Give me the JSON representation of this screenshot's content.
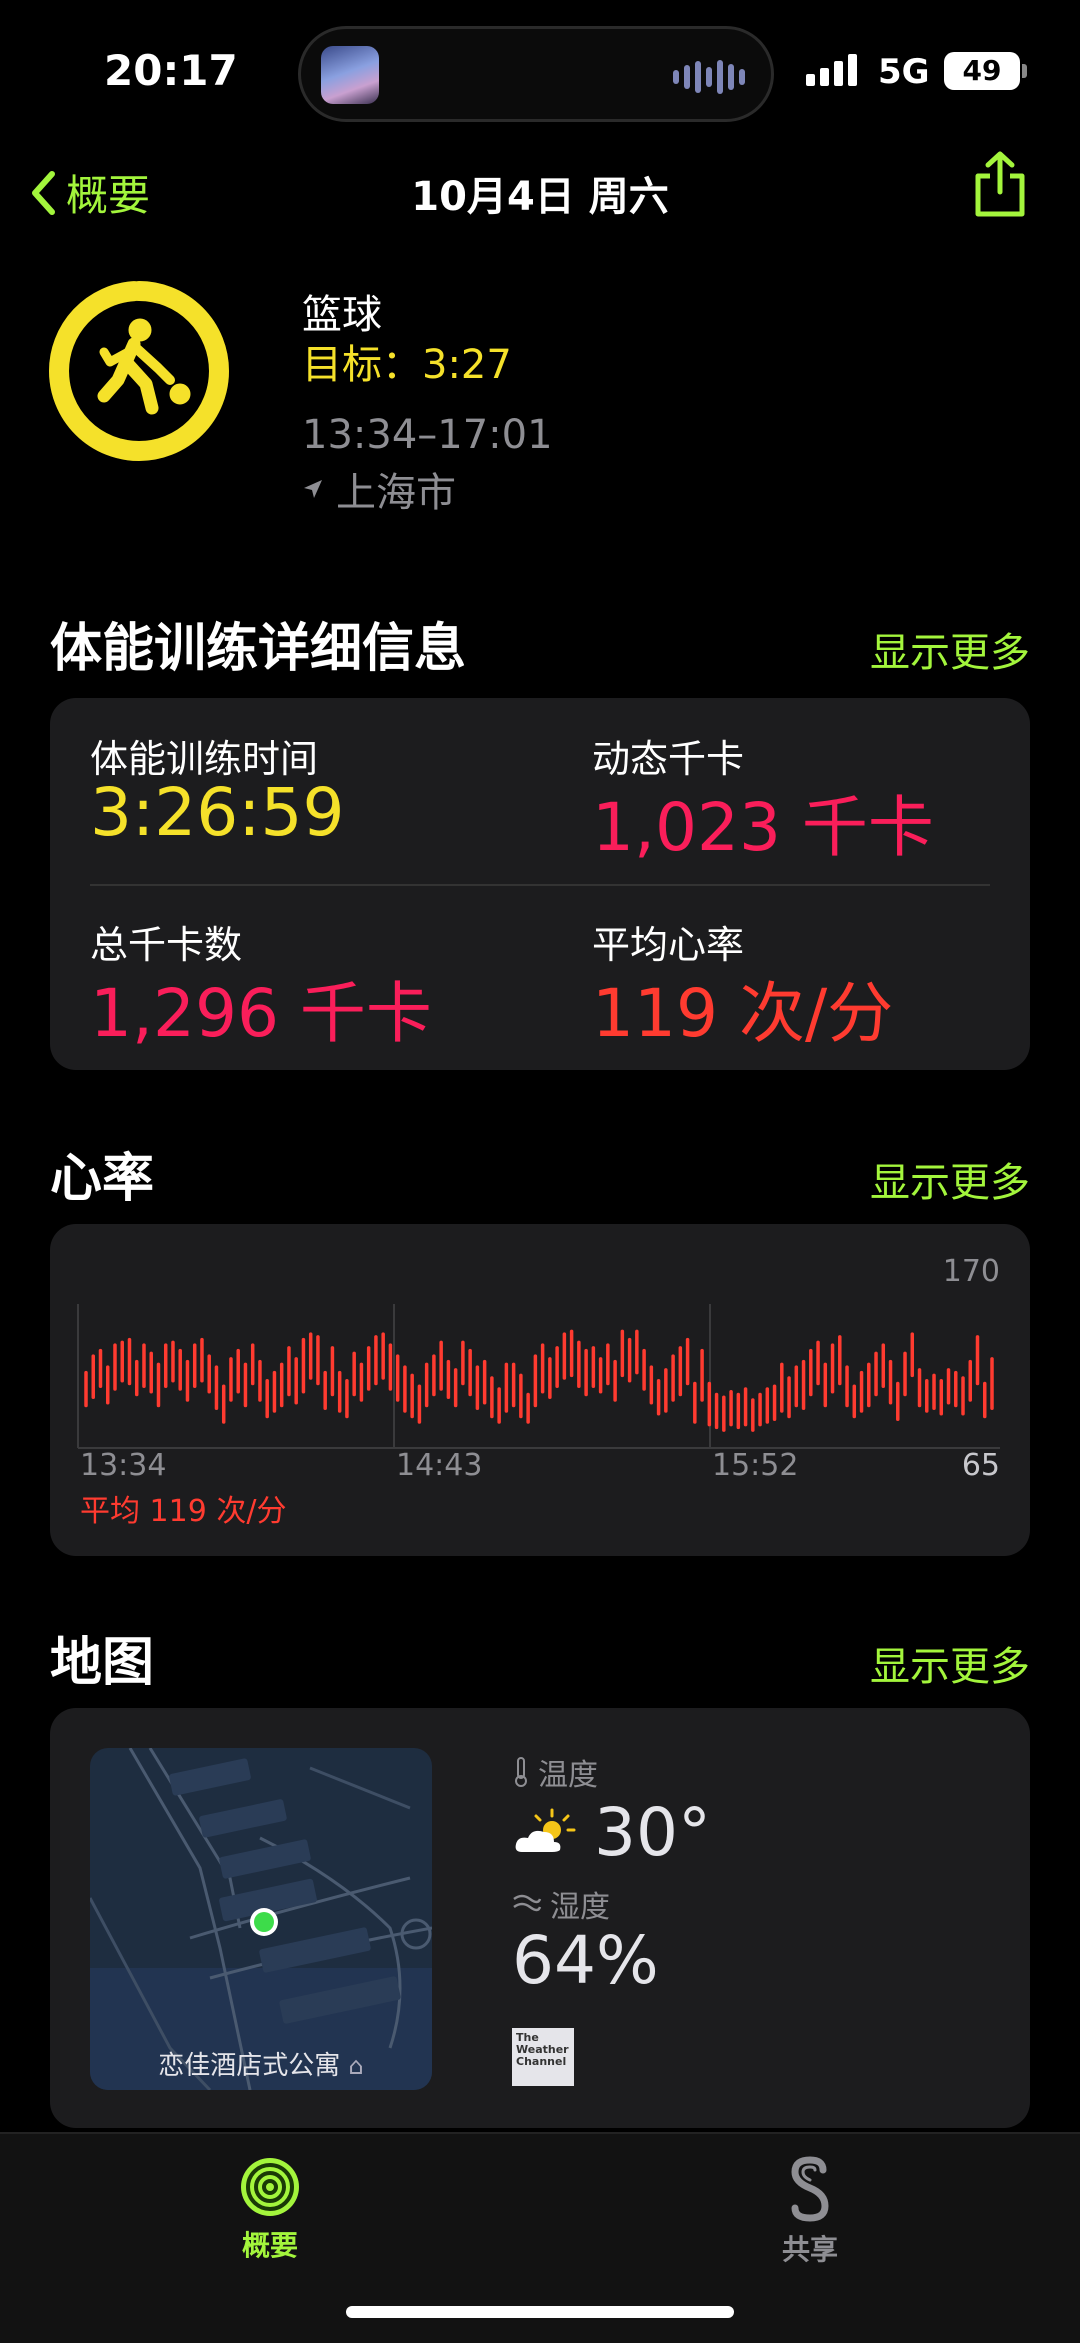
{
  "status_bar": {
    "time": "20:17",
    "network": "5G",
    "battery": "49"
  },
  "nav": {
    "back_label": "概要",
    "title": "10月4日 周六"
  },
  "workout": {
    "name": "篮球",
    "goal": "目标：3:27",
    "time_range": "13:34–17:01",
    "location": "上海市",
    "goal_progress": 0.99,
    "color": "#f5e12a"
  },
  "details": {
    "title": "体能训练详细信息",
    "more": "显示更多",
    "metrics": [
      {
        "label": "体能训练时间",
        "value": "3:26:59"
      },
      {
        "label": "动态千卡",
        "value": "1,023 千卡"
      },
      {
        "label": "总千卡数",
        "value": "1,296 千卡"
      },
      {
        "label": "平均心率",
        "value": "119 次/分"
      }
    ]
  },
  "heart_rate": {
    "title": "心率",
    "more": "显示更多",
    "average": "平均 119 次/分",
    "chart_data": {
      "type": "bar",
      "ylim": [
        65,
        170
      ],
      "y_labels": [
        "170",
        "65"
      ],
      "x_labels": [
        "13:34",
        "14:43",
        "15:52"
      ],
      "ranges": [
        [
          96,
          120
        ],
        [
          102,
          132
        ],
        [
          110,
          136
        ],
        [
          98,
          124
        ],
        [
          108,
          140
        ],
        [
          114,
          142
        ],
        [
          112,
          144
        ],
        [
          104,
          128
        ],
        [
          110,
          140
        ],
        [
          106,
          134
        ],
        [
          96,
          126
        ],
        [
          110,
          140
        ],
        [
          114,
          142
        ],
        [
          108,
          136
        ],
        [
          100,
          128
        ],
        [
          110,
          140
        ],
        [
          114,
          144
        ],
        [
          106,
          132
        ],
        [
          94,
          124
        ],
        [
          84,
          110
        ],
        [
          100,
          130
        ],
        [
          106,
          136
        ],
        [
          96,
          126
        ],
        [
          112,
          140
        ],
        [
          100,
          128
        ],
        [
          88,
          114
        ],
        [
          92,
          120
        ],
        [
          96,
          126
        ],
        [
          104,
          138
        ],
        [
          98,
          130
        ],
        [
          106,
          144
        ],
        [
          116,
          148
        ],
        [
          112,
          146
        ],
        [
          94,
          120
        ],
        [
          104,
          138
        ],
        [
          92,
          120
        ],
        [
          88,
          114
        ],
        [
          104,
          134
        ],
        [
          100,
          126
        ],
        [
          108,
          138
        ],
        [
          112,
          146
        ],
        [
          116,
          148
        ],
        [
          108,
          140
        ],
        [
          100,
          132
        ],
        [
          92,
          124
        ],
        [
          88,
          118
        ],
        [
          84,
          110
        ],
        [
          96,
          126
        ],
        [
          104,
          132
        ],
        [
          108,
          142
        ],
        [
          102,
          128
        ],
        [
          96,
          122
        ],
        [
          112,
          142
        ],
        [
          104,
          136
        ],
        [
          94,
          124
        ],
        [
          98,
          128
        ],
        [
          88,
          116
        ],
        [
          84,
          108
        ],
        [
          92,
          126
        ],
        [
          96,
          126
        ],
        [
          88,
          118
        ],
        [
          84,
          104
        ],
        [
          96,
          132
        ],
        [
          106,
          140
        ],
        [
          102,
          130
        ],
        [
          110,
          138
        ],
        [
          116,
          148
        ],
        [
          118,
          150
        ],
        [
          110,
          142
        ],
        [
          104,
          136
        ],
        [
          110,
          138
        ],
        [
          106,
          130
        ],
        [
          112,
          140
        ],
        [
          100,
          128
        ],
        [
          118,
          150
        ],
        [
          114,
          144
        ],
        [
          120,
          150
        ],
        [
          108,
          136
        ],
        [
          98,
          124
        ],
        [
          90,
          114
        ],
        [
          92,
          122
        ],
        [
          100,
          132
        ],
        [
          104,
          138
        ],
        [
          112,
          144
        ],
        [
          84,
          112
        ],
        [
          100,
          136
        ],
        [
          82,
          112
        ],
        [
          80,
          104
        ],
        [
          78,
          102
        ],
        [
          82,
          106
        ],
        [
          80,
          104
        ],
        [
          82,
          108
        ],
        [
          78,
          100
        ],
        [
          82,
          104
        ],
        [
          84,
          108
        ],
        [
          86,
          110
        ],
        [
          92,
          126
        ],
        [
          88,
          116
        ],
        [
          96,
          124
        ],
        [
          94,
          128
        ],
        [
          104,
          136
        ],
        [
          112,
          142
        ],
        [
          96,
          126
        ],
        [
          106,
          140
        ],
        [
          112,
          146
        ],
        [
          96,
          124
        ],
        [
          88,
          110
        ],
        [
          92,
          120
        ],
        [
          96,
          126
        ],
        [
          104,
          134
        ],
        [
          110,
          140
        ],
        [
          98,
          128
        ],
        [
          86,
          112
        ],
        [
          104,
          134
        ],
        [
          118,
          148
        ],
        [
          96,
          122
        ],
        [
          92,
          114
        ],
        [
          94,
          118
        ],
        [
          90,
          114
        ],
        [
          98,
          122
        ],
        [
          96,
          120
        ],
        [
          90,
          116
        ],
        [
          100,
          128
        ],
        [
          112,
          146
        ],
        [
          88,
          112
        ],
        [
          94,
          130
        ]
      ]
    }
  },
  "map": {
    "title": "地图",
    "more": "显示更多",
    "place": "恋佳酒店式公寓",
    "temp_label": "温度",
    "temp": "30°",
    "humidity_label": "湿度",
    "humidity": "64%",
    "weather_brand": "The Weather Channel"
  },
  "tabs": [
    {
      "label": "概要",
      "icon": "activity-rings-icon",
      "active": true
    },
    {
      "label": "共享",
      "icon": "sharing-icon",
      "active": false
    }
  ]
}
